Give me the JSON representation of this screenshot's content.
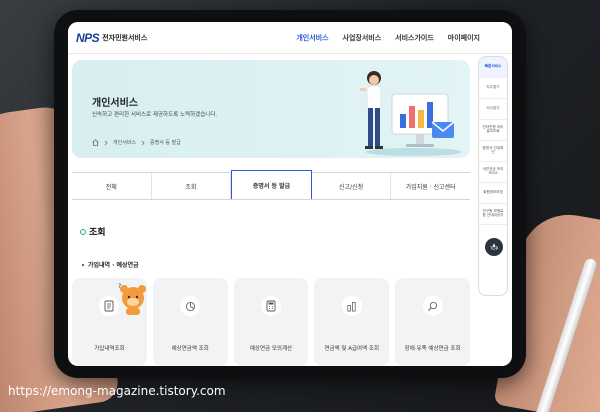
{
  "header": {
    "logo_mark": "NPS",
    "logo_text": "전자민원서비스",
    "nav": [
      "개인서비스",
      "사업장서비스",
      "서비스가이드",
      "마이페이지"
    ],
    "active_nav": 0
  },
  "hero": {
    "title": "개인서비스",
    "description": "신속하고 편리한 서비스로 제공하도록 노력하겠습니다.",
    "breadcrumb": [
      "개인서비스",
      "증명서 등 발급"
    ]
  },
  "tabs": [
    "전체",
    "조회",
    "증명서 등 발급",
    "신고/신청",
    "가입지원 · 신고센터"
  ],
  "active_tab": 2,
  "section_title": "조회",
  "subsection_title": "가입내역 · 예상연금",
  "cards": [
    {
      "label": "가입내역조회",
      "icon": "document-icon"
    },
    {
      "label": "예상연금액 조회",
      "icon": "pie-chart-icon"
    },
    {
      "label": "예상연금 모의계산",
      "icon": "calculator-icon"
    },
    {
      "label": "연금액 및 A급여액 조회",
      "icon": "bar-chart-icon"
    },
    {
      "label": "장애·유족 예상연금 조회",
      "icon": "magnifier-icon"
    }
  ],
  "quick_menu": [
    "빠른서비스",
    "자주찾기",
    "서식찾기",
    "전자민원 처리결과조회",
    "증명서 진위확인",
    "국민연금 모의서비스",
    "회원정보보호",
    "연구원 보험료 등 안내대상자"
  ],
  "top_button": "TOP",
  "watermark": "https://emong-magazine.tistory.com",
  "colors": {
    "accent": "#2a5bd7",
    "hero_bg": "#d8eef1",
    "brand": "#1b3f94",
    "teal": "#2aa59e"
  }
}
